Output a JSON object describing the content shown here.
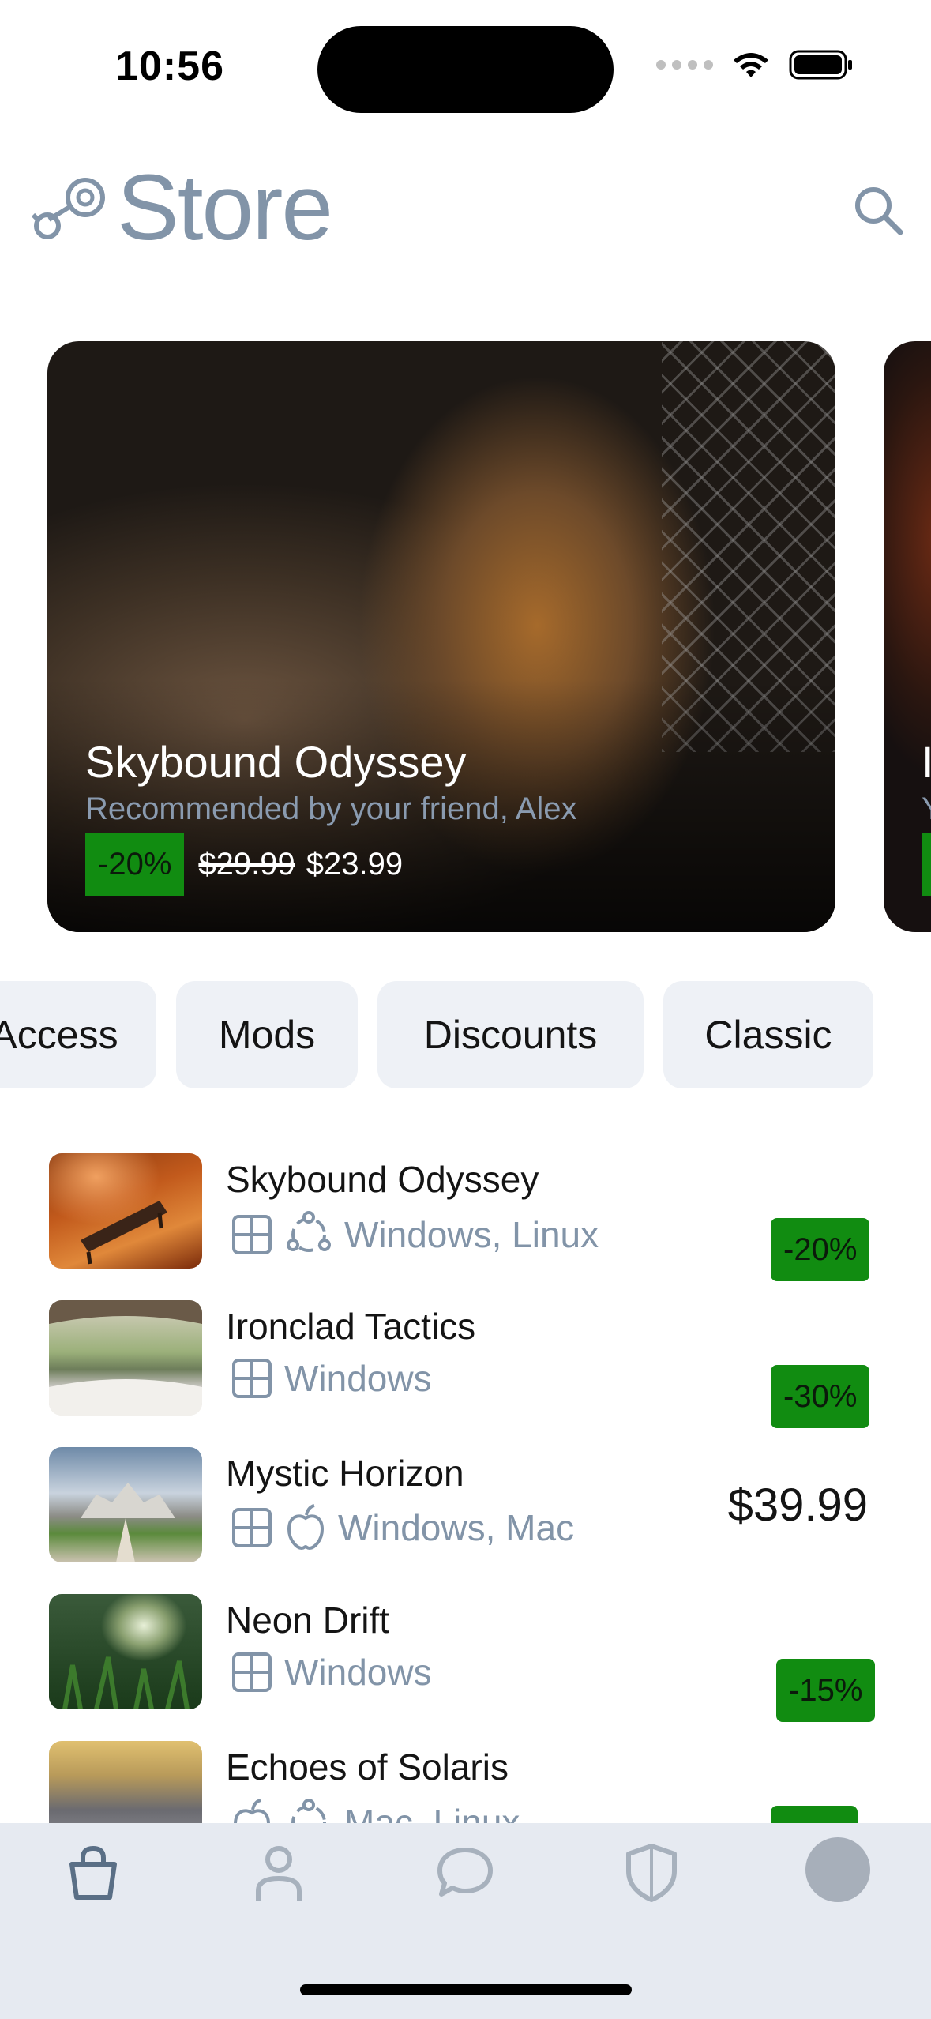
{
  "status_bar": {
    "time": "10:56"
  },
  "header": {
    "title": "Store",
    "logo_icon": "steam-logo-icon",
    "search_icon": "search-icon"
  },
  "hero": {
    "title": "Skybound Odyssey",
    "subtitle": "Recommended by your friend, Alex",
    "discount": "-20%",
    "old_price": "$29.99",
    "new_price": "$23.99",
    "peek_title": "I",
    "peek_subtitle": "Y"
  },
  "categories": [
    "Access",
    "Mods",
    "Discounts",
    "Classic"
  ],
  "games": [
    {
      "name": "Skybound Odyssey",
      "platforms": "Windows, Linux",
      "icons": [
        "windows-icon",
        "linux-icon"
      ],
      "discount": "-20%",
      "price": ""
    },
    {
      "name": "Ironclad Tactics",
      "platforms": "Windows",
      "icons": [
        "windows-icon"
      ],
      "discount": "-30%",
      "price": ""
    },
    {
      "name": "Mystic Horizon",
      "platforms": "Windows, Mac",
      "icons": [
        "windows-icon",
        "apple-icon"
      ],
      "discount": "",
      "price": "$39.99"
    },
    {
      "name": "Neon Drift",
      "platforms": "Windows",
      "icons": [
        "windows-icon"
      ],
      "discount": "-15%",
      "price": ""
    },
    {
      "name": "Echoes of Solaris",
      "platforms": "Mac, Linux",
      "icons": [
        "apple-icon",
        "linux-icon"
      ],
      "discount": "",
      "price": ""
    }
  ],
  "tab_bar": {
    "icons": [
      "store-bag-icon",
      "profile-icon",
      "chat-icon",
      "shield-icon",
      "avatar"
    ]
  },
  "colors": {
    "accent": "#8294a8",
    "discount_green": "#118c11",
    "chip_bg": "#eef1f6",
    "tab_bar_bg": "#e6eaf1"
  }
}
